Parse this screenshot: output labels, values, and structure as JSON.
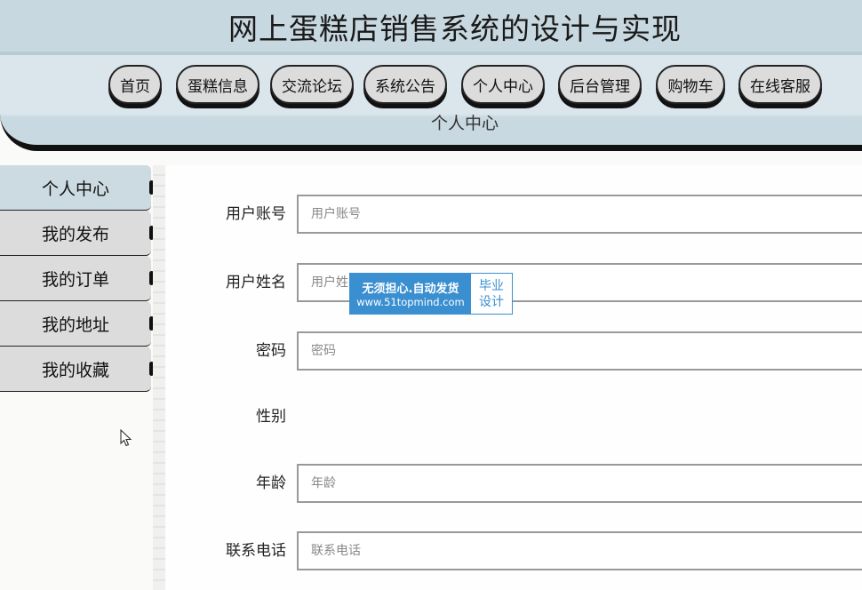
{
  "header": {
    "site_title": "网上蛋糕店销售系统的设计与实现",
    "subtitle": "个人中心"
  },
  "nav": {
    "items": [
      {
        "label": "首页"
      },
      {
        "label": "蛋糕信息"
      },
      {
        "label": "交流论坛"
      },
      {
        "label": "系统公告"
      },
      {
        "label": "个人中心"
      },
      {
        "label": "后台管理"
      },
      {
        "label": "购物车"
      },
      {
        "label": "在线客服"
      }
    ]
  },
  "sidebar": {
    "active_index": 0,
    "items": [
      {
        "label": "个人中心"
      },
      {
        "label": "我的发布"
      },
      {
        "label": "我的订单"
      },
      {
        "label": "我的地址"
      },
      {
        "label": "我的收藏"
      }
    ]
  },
  "form": {
    "fields": [
      {
        "label": "用户账号",
        "placeholder": "用户账号",
        "value": ""
      },
      {
        "label": "用户姓名",
        "placeholder": "用户姓名",
        "value": ""
      },
      {
        "label": "密码",
        "placeholder": "密码",
        "value": ""
      },
      {
        "label": "性别"
      },
      {
        "label": "年龄",
        "placeholder": "年龄",
        "value": ""
      },
      {
        "label": "联系电话",
        "placeholder": "联系电话",
        "value": ""
      }
    ]
  },
  "watermark": {
    "line1": "无须担心.自动发货",
    "line2": "www.51topmind.com",
    "right1": "毕业",
    "right2": "设计"
  },
  "colors": {
    "header_bg": "#c8d8e0",
    "nav_button": "#dcdcdc",
    "sidebar_active": "#ccdbe2",
    "badge_blue": "#3a8fd0"
  }
}
